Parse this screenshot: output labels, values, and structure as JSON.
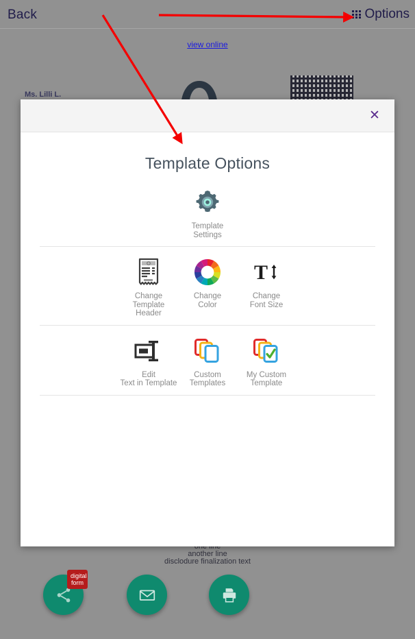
{
  "topbar": {
    "back_label": "Back",
    "options_label": "Options",
    "grid_icon": "grid-icon"
  },
  "background": {
    "view_online_label": "view online",
    "left_text": "Ms. Lilli L.",
    "qr_icon": "qr-code",
    "logo_icon": "company-logo",
    "bottom_lines": [
      "one line",
      "another line",
      "disclodure finalization text"
    ],
    "fabs": [
      {
        "name": "share",
        "icon": "share-icon",
        "badge": "digital\nform"
      },
      {
        "name": "email",
        "icon": "envelope-icon",
        "badge": ""
      },
      {
        "name": "print",
        "icon": "printer-icon",
        "badge": ""
      }
    ]
  },
  "modal": {
    "title": "Template Options",
    "close_label": "✕",
    "sections": [
      {
        "items": [
          {
            "label": "Template Settings",
            "icon": "gear-icon"
          }
        ]
      },
      {
        "items": [
          {
            "label": "Change\nTemplate Header",
            "icon": "receipt-icon"
          },
          {
            "label": "Change\nColor",
            "icon": "color-wheel-icon"
          },
          {
            "label": "Change\nFont Size",
            "icon": "font-size-icon"
          }
        ]
      },
      {
        "items": [
          {
            "label": "Edit\nText in Template",
            "icon": "text-cursor-icon"
          },
          {
            "label": "Custom\nTemplates",
            "icon": "stacked-pages-icon"
          },
          {
            "label": "My Custom\nTemplate",
            "icon": "stacked-pages-check-icon"
          }
        ]
      }
    ]
  },
  "colors": {
    "accent_teal": "#0f8a6e",
    "badge_red": "#b51c1c",
    "annotation_red": "#f40000",
    "title_slate": "#46525e",
    "link_blue": "#1a1ae0",
    "close_purple": "#5b2d8e",
    "overlay_gray": "#919191"
  }
}
